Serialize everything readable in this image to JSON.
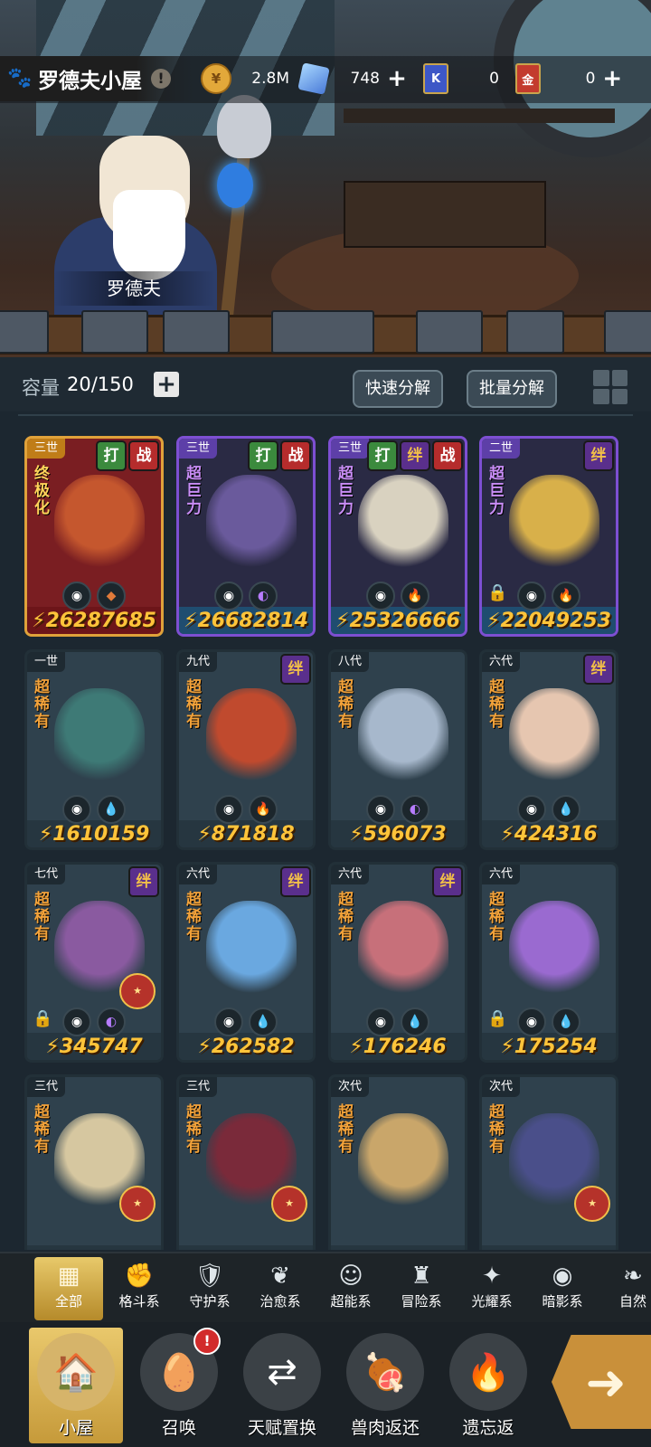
{
  "scene": {
    "npc_name": "罗德夫"
  },
  "topbar": {
    "home_title": "罗德夫小屋",
    "info": "!",
    "coins": {
      "value": "2.8M",
      "icon": "coin-icon"
    },
    "crystals": {
      "value": "748",
      "icon": "crystal-icon"
    },
    "blue_ticket": {
      "value": "0",
      "icon_text": "K"
    },
    "gold_ticket": {
      "value": "0",
      "icon_text": "金"
    }
  },
  "capacity": {
    "label": "容量",
    "value": "20/150",
    "quick_decompose": "快速分解",
    "batch_decompose": "批量分解"
  },
  "cards": [
    {
      "gen": "三世",
      "tags": [
        "打",
        "战"
      ],
      "rarity": "终极化",
      "power": "26287685",
      "elements": [
        "eye",
        "rock"
      ],
      "locked": false
    },
    {
      "gen": "三世",
      "tags": [
        "打",
        "战"
      ],
      "rarity": "超巨力",
      "power": "26682814",
      "elements": [
        "eye",
        "moon"
      ],
      "locked": false
    },
    {
      "gen": "三世",
      "tags": [
        "打",
        "绊",
        "战"
      ],
      "rarity": "超巨力",
      "power": "25326666",
      "elements": [
        "eye",
        "fire"
      ],
      "locked": false
    },
    {
      "gen": "二世",
      "tags": [
        "绊"
      ],
      "rarity": "超巨力",
      "power": "22049253",
      "elements": [
        "eye",
        "fire"
      ],
      "locked": true
    },
    {
      "gen": "一世",
      "tags": [],
      "rarity": "超稀有",
      "power": "1610159",
      "elements": [
        "eye",
        "water"
      ],
      "locked": false
    },
    {
      "gen": "九代",
      "tags": [
        "绊"
      ],
      "rarity": "超稀有",
      "power": "871818",
      "elements": [
        "eye",
        "fire"
      ],
      "locked": false
    },
    {
      "gen": "八代",
      "tags": [],
      "rarity": "超稀有",
      "power": "596073",
      "elements": [
        "eye",
        "moon"
      ],
      "locked": false
    },
    {
      "gen": "六代",
      "tags": [
        "绊"
      ],
      "rarity": "超稀有",
      "power": "424316",
      "elements": [
        "eye",
        "water"
      ],
      "locked": false
    },
    {
      "gen": "七代",
      "tags": [
        "绊"
      ],
      "rarity": "超稀有",
      "power": "345747",
      "elements": [
        "eye",
        "moon"
      ],
      "locked": true
    },
    {
      "gen": "六代",
      "tags": [
        "绊"
      ],
      "rarity": "超稀有",
      "power": "262582",
      "elements": [
        "eye",
        "water"
      ],
      "locked": false
    },
    {
      "gen": "六代",
      "tags": [
        "绊"
      ],
      "rarity": "超稀有",
      "power": "176246",
      "elements": [
        "eye",
        "water"
      ],
      "locked": false
    },
    {
      "gen": "六代",
      "tags": [],
      "rarity": "超稀有",
      "power": "175254",
      "elements": [
        "eye",
        "water"
      ],
      "locked": true
    },
    {
      "gen": "三代",
      "tags": [],
      "rarity": "超稀有",
      "power": "",
      "elements": [],
      "locked": false
    },
    {
      "gen": "三代",
      "tags": [],
      "rarity": "超稀有",
      "power": "",
      "elements": [],
      "locked": false
    },
    {
      "gen": "次代",
      "tags": [],
      "rarity": "超稀有",
      "power": "",
      "elements": [],
      "locked": false
    },
    {
      "gen": "次代",
      "tags": [],
      "rarity": "超稀有",
      "power": "",
      "elements": [],
      "locked": false
    }
  ],
  "filters": [
    {
      "label": "全部",
      "icon": "all-icon"
    },
    {
      "label": "格斗系",
      "icon": "fist-icon"
    },
    {
      "label": "守护系",
      "icon": "shield-icon"
    },
    {
      "label": "治愈系",
      "icon": "sprout-icon"
    },
    {
      "label": "超能系",
      "icon": "alien-icon"
    },
    {
      "label": "冒险系",
      "icon": "lantern-icon"
    },
    {
      "label": "光耀系",
      "icon": "star-compass-icon"
    },
    {
      "label": "暗影系",
      "icon": "dark-eye-icon"
    },
    {
      "label": "自然",
      "icon": "leaf-icon"
    }
  ],
  "nav": [
    {
      "label": "小屋",
      "icon": "house-icon"
    },
    {
      "label": "召唤",
      "icon": "egg-icon",
      "badge": "!"
    },
    {
      "label": "天赋置换",
      "icon": "swap-icon"
    },
    {
      "label": "兽肉返还",
      "icon": "meat-icon"
    },
    {
      "label": "遗忘返",
      "icon": "flame-icon"
    }
  ]
}
